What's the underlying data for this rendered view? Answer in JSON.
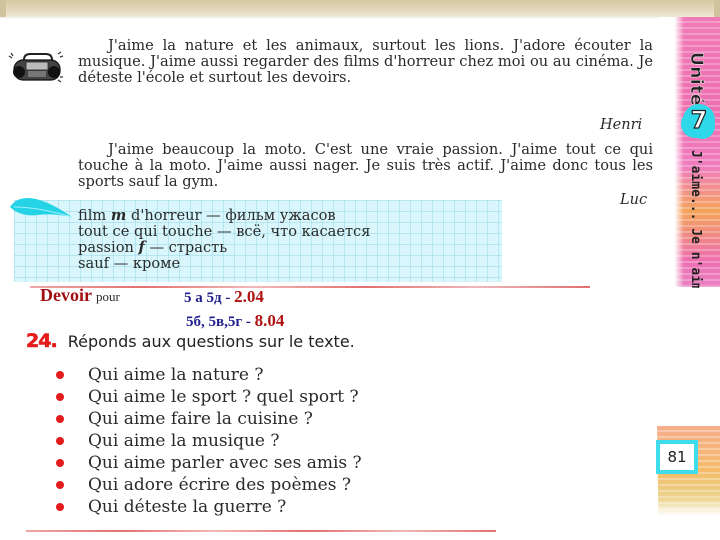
{
  "textbook": {
    "unit": {
      "label": "Unité",
      "number": "7",
      "subtitle": "J'aime... Je n'aime pas"
    },
    "texts": [
      {
        "paragraph": "J'aime la nature et les animaux, surtout les lions. J'adore écouter la musique. J'aime aussi regarder des films d'horreur chez moi ou au cinéma. Je déteste l'école et surtout les devoirs.",
        "author": "Henri",
        "icon": "radio-cassette-icon"
      },
      {
        "paragraph": "J'aime beaucoup la moto. C'est une vraie passion. J'aime tout ce qui touche à la moto. J'aime aussi nager. Je suis très actif. J'aime donc tous les sports sauf la gym.",
        "author": "Luc"
      }
    ],
    "vocabulary": {
      "icon": "feather-icon",
      "items": [
        {
          "term": "film",
          "gram": "m",
          "rest": "d'horreur",
          "translation": "фильм ужасов"
        },
        {
          "term": "tout ce qui touche",
          "gram": "",
          "rest": "",
          "translation": "всё, что касается"
        },
        {
          "term": "passion",
          "gram": "f",
          "rest": "",
          "translation": "страсть"
        },
        {
          "term": "sauf",
          "gram": "",
          "rest": "",
          "translation": "кроме"
        }
      ]
    },
    "homework": {
      "title": "Devoir",
      "pour": "pour",
      "groups": [
        {
          "classes": "5 а  5д -",
          "date": "2.04"
        },
        {
          "classes": "5б, 5в,5г  -",
          "date": "8.04"
        }
      ]
    },
    "exercise": {
      "number": "24.",
      "instruction": "Réponds aux questions sur le texte.",
      "questions": [
        "Qui aime la nature ?",
        "Qui aime le sport ? quel sport ?",
        "Qui aime faire la cuisine ?",
        "Qui aime la musique ?",
        "Qui aime parler avec ses amis ?",
        "Qui adore écrire des poèmes ?",
        "Qui déteste la guerre ?"
      ]
    },
    "page_number": "81"
  },
  "colors": {
    "homework_title": "#a01010",
    "homework_classes": "#232190",
    "exercise_number": "#e51d1d",
    "bullet": "#e31b1b",
    "vocab_bg": "#d8f6fb",
    "unit_badge": "#2fd8e8"
  }
}
